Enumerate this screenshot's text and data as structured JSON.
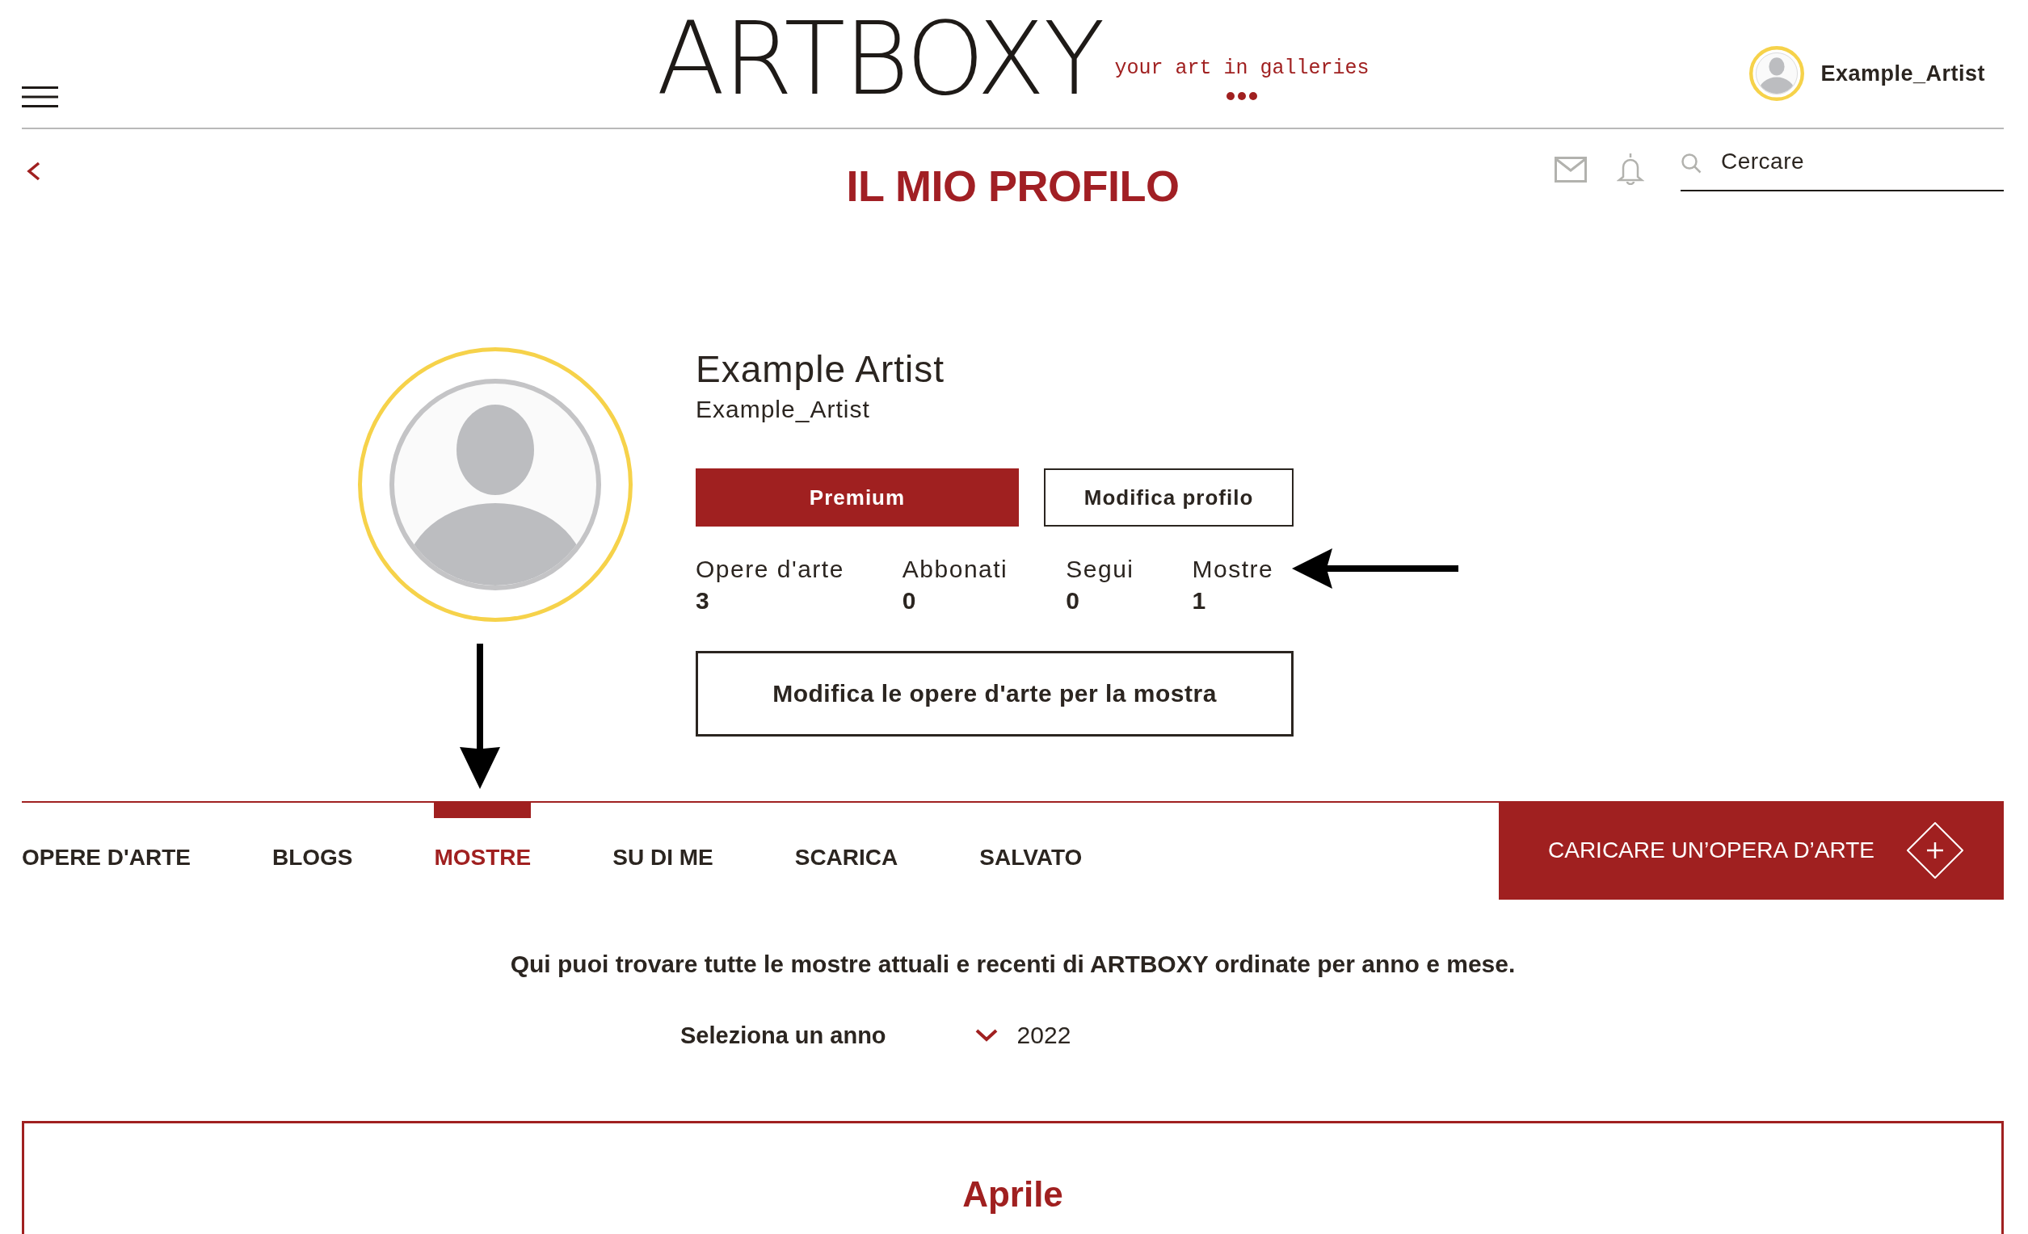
{
  "header": {
    "logo": {
      "wordmark": "ARTBOXY",
      "tagline": "your art in galleries"
    },
    "account": {
      "username": "Example_Artist"
    }
  },
  "search": {
    "placeholder": "Cercare"
  },
  "page_title": "IL MIO PROFILO",
  "profile": {
    "name": "Example Artist",
    "username": "Example_Artist",
    "buttons": [
      {
        "label": "Premium",
        "kind": "primary"
      },
      {
        "label": "Modifica profilo",
        "kind": "outline"
      }
    ],
    "stats": [
      {
        "label": "Opere d'arte",
        "value": "3"
      },
      {
        "label": "Abbonati",
        "value": "0"
      },
      {
        "label": "Segui",
        "value": "0"
      },
      {
        "label": "Mostre",
        "value": "1"
      }
    ],
    "edit_button": "Modifica le opere d'arte per la mostra"
  },
  "tabs": [
    {
      "label": "OPERE D'ARTE",
      "selected": false
    },
    {
      "label": "BLOGS",
      "selected": false
    },
    {
      "label": "MOSTRE",
      "selected": true
    },
    {
      "label": "SU DI ME",
      "selected": false
    },
    {
      "label": "SCARICA",
      "selected": false
    },
    {
      "label": "SALVATO",
      "selected": false
    }
  ],
  "upload_button": {
    "label": "CARICARE UN’OPERA D’ARTE"
  },
  "exhibitions": {
    "intro": "Qui puoi trovare tutte le mostre attuali e recenti di ARTBOXY ordinate per anno e mese.",
    "year_select": {
      "label": "Seleziona un anno",
      "value": "2022"
    },
    "months": [
      {
        "title": "Aprile"
      }
    ]
  }
}
